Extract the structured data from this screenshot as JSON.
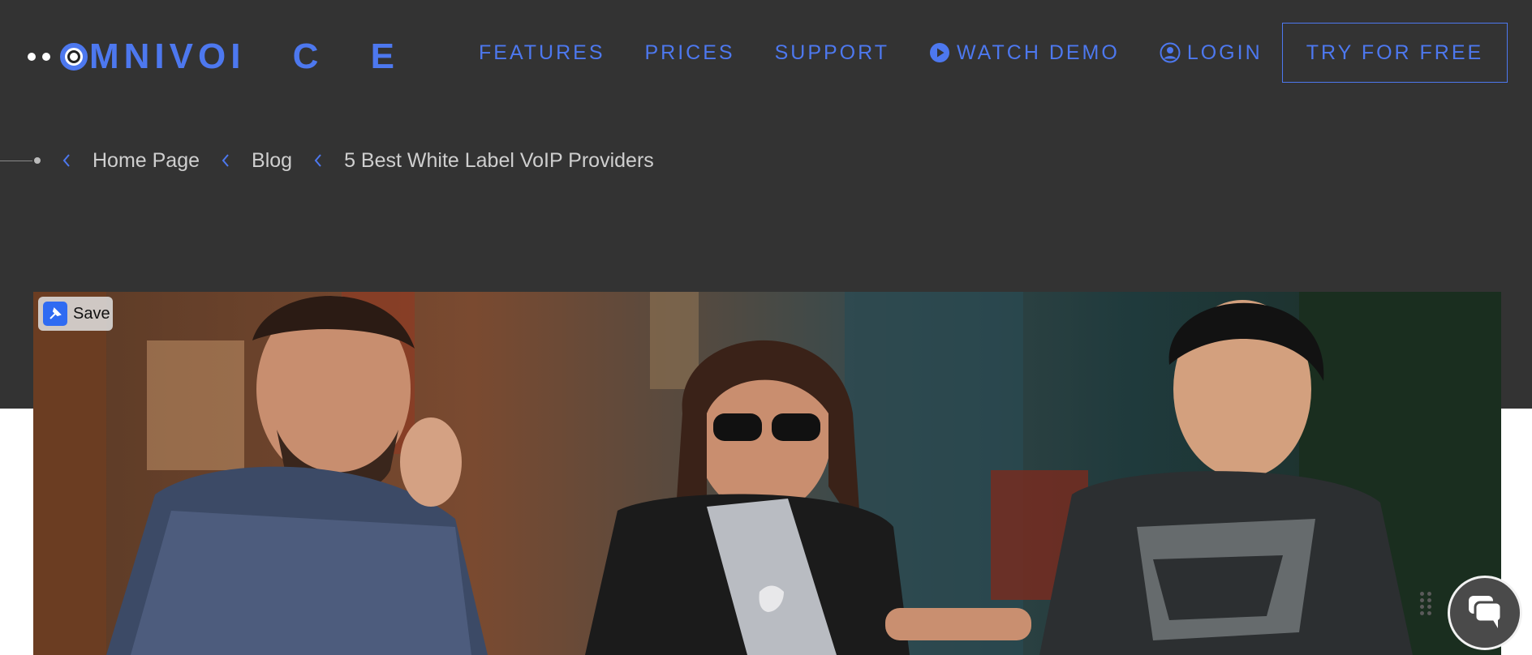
{
  "brand": {
    "logo_text_main": "MNIVO",
    "logo_text_spaced": "I C E",
    "accent_color": "#4d78ef"
  },
  "nav": {
    "items": [
      {
        "label": "FEATURES"
      },
      {
        "label": "PRICES"
      },
      {
        "label": "SUPPORT"
      },
      {
        "label": "WATCH DEMO",
        "icon": "play-circle-icon"
      },
      {
        "label": "LOGIN",
        "icon": "user-circle-icon"
      }
    ],
    "cta_label": "TRY FOR FREE"
  },
  "breadcrumb": {
    "items": [
      {
        "label": "Home Page"
      },
      {
        "label": "Blog"
      },
      {
        "label": "5 Best White Label VoIP Providers"
      }
    ],
    "separator_icon": "chevron-left-icon"
  },
  "hero": {
    "save_label": "Save",
    "save_icon": "pin-icon"
  },
  "chat": {
    "icon": "chat-bubbles-icon",
    "drag_icon": "drag-handle-icon"
  }
}
